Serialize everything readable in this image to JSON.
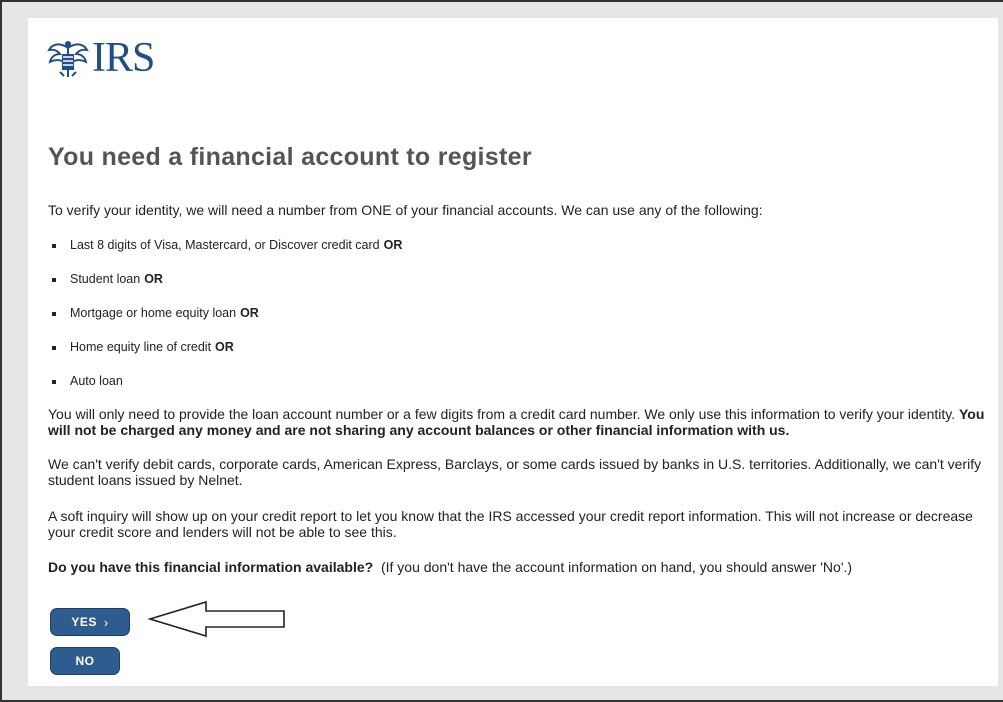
{
  "logo": {
    "text": "IRS"
  },
  "page": {
    "title": "You need a financial account to register",
    "intro": "To verify your identity, we will need a number from ONE of your financial accounts. We can use any of the following:",
    "options": [
      {
        "label": "Last 8 digits of Visa, Mastercard, or Discover credit card",
        "conj": "OR"
      },
      {
        "label": "Student loan",
        "conj": "OR"
      },
      {
        "label": "Mortgage or home equity loan",
        "conj": "OR"
      },
      {
        "label": "Home equity line of credit",
        "conj": "OR"
      },
      {
        "label": "Auto loan",
        "conj": ""
      }
    ],
    "para1": "You will only need to provide the loan account number or a few digits from a credit card number. We only use this information to verify your identity.",
    "para1_bold": "You will not be charged any money and are not sharing any account balances or other financial information with us.",
    "para2": "We can't verify debit cards, corporate cards, American Express, Barclays, or some cards issued by banks in U.S. territories. Additionally, we can't verify student loans issued by Nelnet.",
    "para3": "A soft inquiry will show up on your credit report to let you know that the IRS accessed your credit report information. This will not increase or decrease your credit score and lenders will not be able to see this.",
    "question": "Do you have this financial information available?",
    "question_note": "(If you don't have the account information on hand, you should answer 'No'.)"
  },
  "buttons": {
    "yes": "YES",
    "yes_icon": "›",
    "no": "NO"
  },
  "colors": {
    "button_bg": "#2e5c8e",
    "logo": "#1f4e8c",
    "title": "#555555"
  },
  "icons": {
    "logo": "irs-eagle-icon",
    "annotation": "left-arrow-icon"
  }
}
